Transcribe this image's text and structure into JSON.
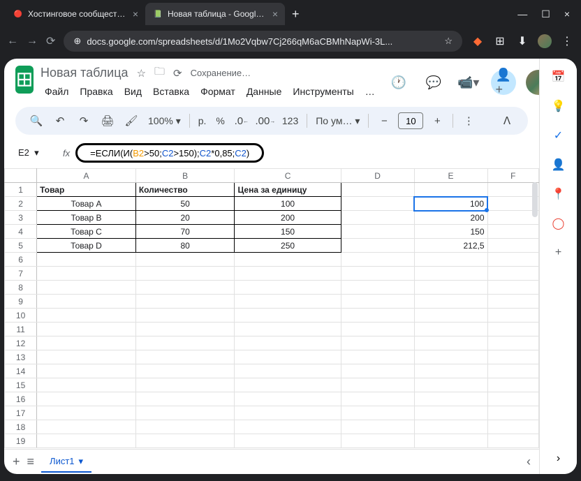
{
  "browser": {
    "tabs": [
      {
        "icon": "🔴",
        "title": "Хостинговое сообщество «Tim"
      },
      {
        "icon": "📗",
        "title": "Новая таблица - Google Табли"
      }
    ],
    "url": "docs.google.com/spreadsheets/d/1Mo2Vqbw7Cj266qM6aCBMhNapWi-3L..."
  },
  "app": {
    "title": "Новая таблица",
    "status": "Сохранение…",
    "menus": [
      "Файл",
      "Правка",
      "Вид",
      "Вставка",
      "Формат",
      "Данные",
      "Инструменты",
      "…"
    ]
  },
  "toolbar": {
    "zoom": "100%",
    "currency": "р.",
    "percent": "%",
    "dec_dec": ".0",
    "inc_dec": ".00",
    "num_fmt": "123",
    "font": "По ум…",
    "font_size": "10"
  },
  "formula": {
    "cell_ref": "E2",
    "full": "=ЕСЛИ(И(B2>50; C2>150); C2*0,85; C2)",
    "parts": {
      "p1": "=ЕСЛИ(И(",
      "ref_b2": "B2",
      "gt50": ">50; ",
      "ref_c2a": "C2",
      "gt150": ">150); ",
      "ref_c2b": "C2",
      "mult": "*0,85; ",
      "ref_c2c": "C2",
      "close": ")"
    }
  },
  "columns": [
    "A",
    "B",
    "C",
    "D",
    "E",
    "F"
  ],
  "headers": {
    "a": "Товар",
    "b": "Количество",
    "c": "Цена за единицу"
  },
  "data": [
    {
      "a": "Товар A",
      "b": "50",
      "c": "100",
      "e": "100"
    },
    {
      "a": "Товар B",
      "b": "20",
      "c": "200",
      "e": "200"
    },
    {
      "a": "Товар C",
      "b": "70",
      "c": "150",
      "e": "150"
    },
    {
      "a": "Товар D",
      "b": "80",
      "c": "250",
      "e": "212,5"
    }
  ],
  "sheet_tab": "Лист1"
}
